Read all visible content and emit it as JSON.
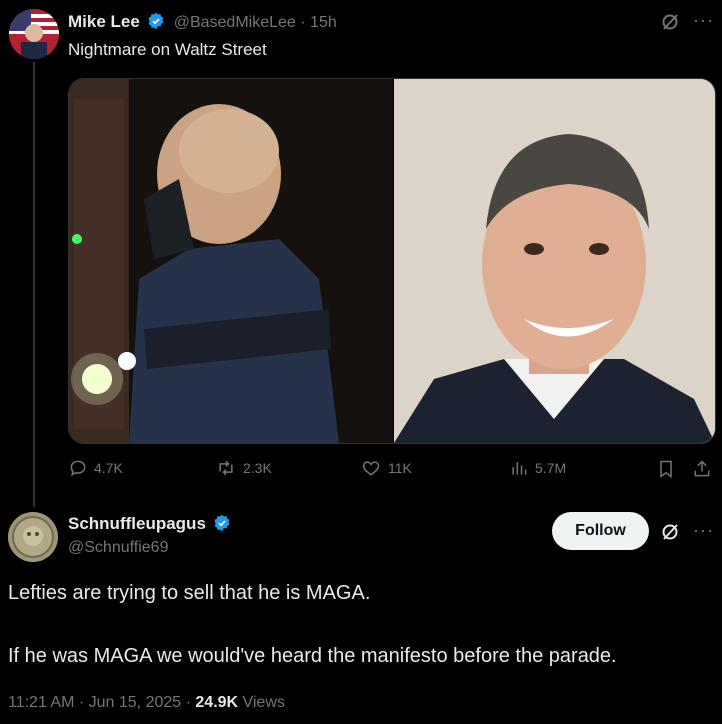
{
  "tweet": {
    "author_name": "Mike Lee",
    "handle": "@BasedMikeLee",
    "time": "· 15h",
    "text": "Nightmare on Waltz Street",
    "stats": {
      "replies": "4.7K",
      "reposts": "2.3K",
      "likes": "11K",
      "views": "5.7M"
    }
  },
  "reply": {
    "author_name": "Schnuffleupagus",
    "handle": "@Schnuffie69",
    "follow_label": "Follow",
    "line1": "Lefties are trying to sell that he is MAGA.",
    "line2": "If he was MAGA we would've heard the manifesto before the parade.",
    "time": "11:21 AM · Jun 15, 2025 ·",
    "views_count": "24.9K",
    "views_label": "Views"
  },
  "colors": {
    "background": "#000000",
    "verified": "#1d9bf0",
    "muted": "#71767b",
    "text": "#e7e9ea"
  }
}
